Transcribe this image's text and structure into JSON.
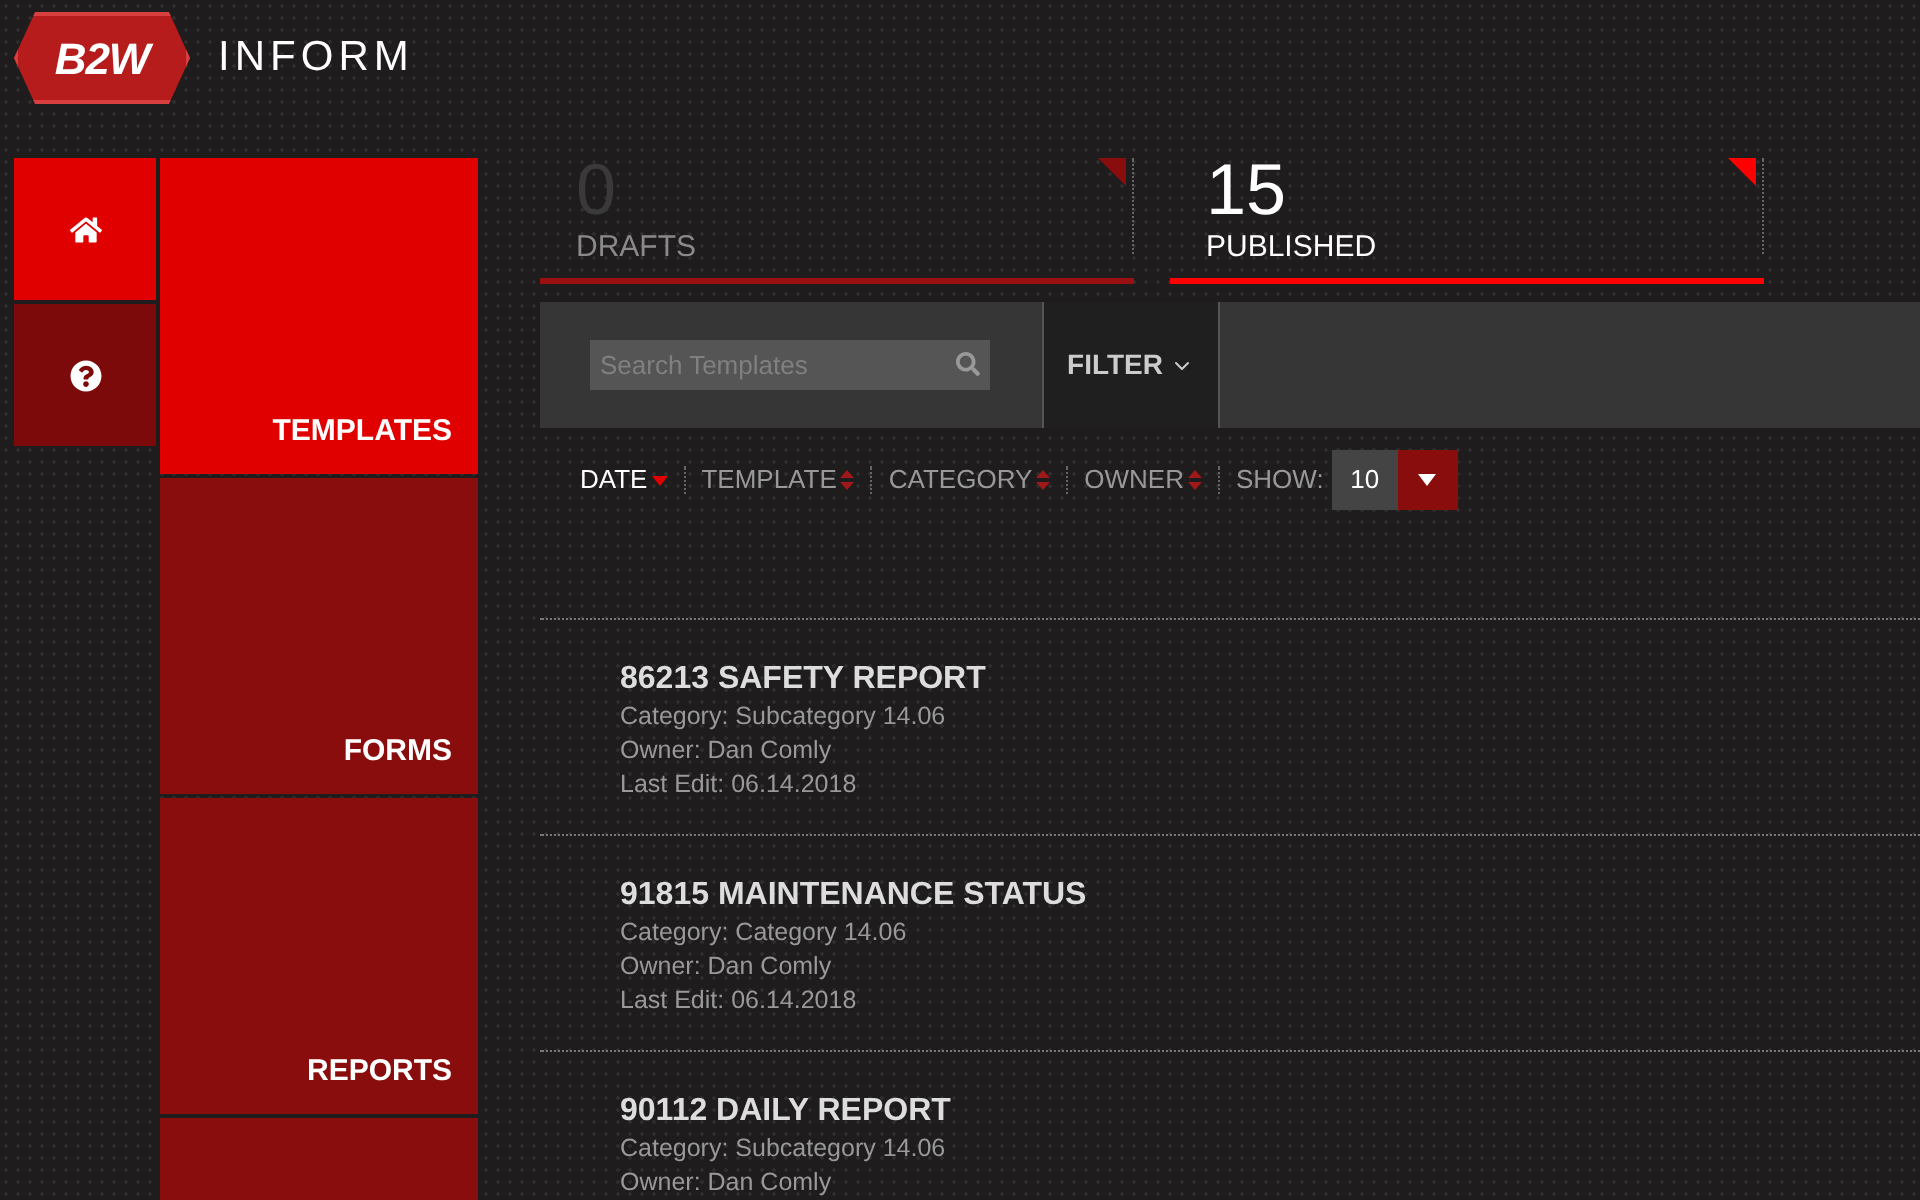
{
  "logo": {
    "mark": "B2W",
    "title": "INFORM"
  },
  "icon_nav": [
    {
      "kind": "home",
      "selected": true
    },
    {
      "kind": "help",
      "selected": false
    }
  ],
  "nav": [
    {
      "label": "TEMPLATES",
      "selected": true
    },
    {
      "label": "FORMS",
      "selected": false
    },
    {
      "label": "REPORTS",
      "selected": false
    }
  ],
  "stats": [
    {
      "count": "0",
      "label": "DRAFTS",
      "selected": false
    },
    {
      "count": "15",
      "label": "PUBLISHED",
      "selected": true
    }
  ],
  "toolbar": {
    "search": {
      "placeholder": "Search Templates"
    },
    "filter": "FILTER"
  },
  "sort": [
    {
      "label": "DATE",
      "selected": true
    },
    {
      "label": "TEMPLATE",
      "selected": false
    },
    {
      "label": "CATEGORY",
      "selected": false
    },
    {
      "label": "OWNER",
      "selected": false
    }
  ],
  "show": {
    "label": "SHOW:",
    "value": "10"
  },
  "templates": [
    {
      "title": "86213 SAFETY REPORT",
      "lines": [
        "Category: Subcategory 14.06",
        "Owner: Dan Comly",
        "Last Edit: 06.14.2018"
      ]
    },
    {
      "title": "91815 MAINTENANCE STATUS",
      "lines": [
        "Category: Category 14.06",
        "Owner: Dan Comly",
        "Last Edit: 06.14.2018"
      ]
    },
    {
      "title": "90112 DAILY REPORT",
      "lines": [
        "Category: Subcategory 14.06",
        "Owner: Dan Comly"
      ]
    }
  ]
}
